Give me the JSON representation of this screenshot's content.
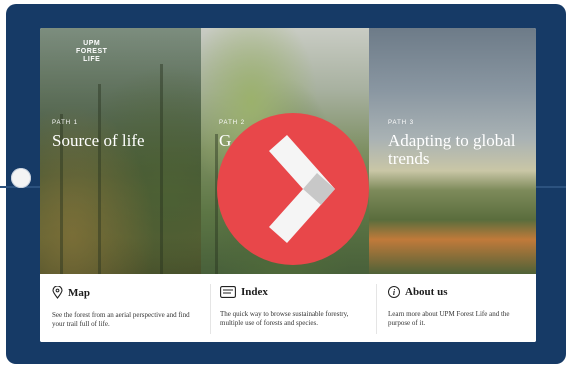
{
  "brand": {
    "line1": "UPM",
    "line2": "FOREST",
    "line3": "LIFE"
  },
  "paths": [
    {
      "number": "PATH 1",
      "title": "Source of life"
    },
    {
      "number": "PATH 2",
      "title": "G"
    },
    {
      "number": "PATH 3",
      "title": "Adapting to global trends"
    }
  ],
  "bottom": {
    "map": {
      "title": "Map",
      "desc": "See the forest from an aerial perspective and find your trail full of life."
    },
    "index": {
      "title": "Index",
      "desc": "The quick way to browse sustainable forestry, multiple use of forests and species."
    },
    "about": {
      "title": "About us",
      "desc": "Learn more about UPM Forest Life and the purpose of it."
    }
  },
  "colors": {
    "tablet": "#163a66",
    "play": "#e8474a"
  },
  "icons": {
    "play": "chevron-right-icon",
    "map": "map-pin-icon",
    "index": "index-icon",
    "about": "info-icon"
  }
}
